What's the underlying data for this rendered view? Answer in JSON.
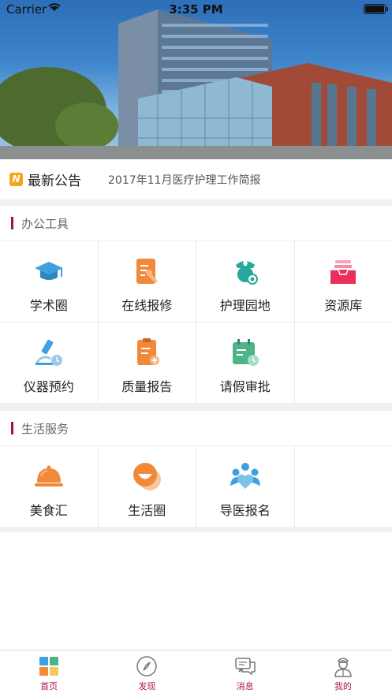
{
  "status_bar": {
    "carrier": "Carrier",
    "time": "3:35 PM"
  },
  "notice": {
    "badge": "N",
    "label": "最新公告",
    "text": "2017年11月医疗护理工作简报"
  },
  "office_tools": {
    "title": "办公工具",
    "items": [
      {
        "label": "学术圈",
        "icon": "graduation-cap-icon"
      },
      {
        "label": "在线报修",
        "icon": "repair-clipboard-icon"
      },
      {
        "label": "护理园地",
        "icon": "nurse-icon"
      },
      {
        "label": "资源库",
        "icon": "inbox-icon"
      },
      {
        "label": "仪器预约",
        "icon": "microscope-icon"
      },
      {
        "label": "质量报告",
        "icon": "report-icon"
      },
      {
        "label": "请假审批",
        "icon": "calendar-clock-icon"
      }
    ]
  },
  "life_services": {
    "title": "生活服务",
    "items": [
      {
        "label": "美食汇",
        "icon": "food-cloche-icon"
      },
      {
        "label": "生活圈",
        "icon": "smile-circle-icon"
      },
      {
        "label": "导医报名",
        "icon": "people-heart-icon"
      }
    ]
  },
  "tabbar": {
    "items": [
      {
        "label": "首页",
        "icon": "home-grid-icon"
      },
      {
        "label": "发现",
        "icon": "compass-icon"
      },
      {
        "label": "消息",
        "icon": "chat-icon"
      },
      {
        "label": "我的",
        "icon": "doctor-icon"
      }
    ]
  },
  "colors": {
    "accent": "#a0124a",
    "orange": "#f08a3a",
    "teal": "#27a89a",
    "blue": "#3fa0e0"
  }
}
